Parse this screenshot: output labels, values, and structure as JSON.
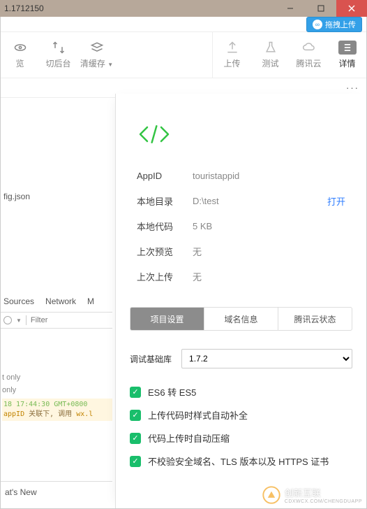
{
  "title": "1.1712150",
  "drag_upload": "拖拽上传",
  "toolbar": {
    "left": [
      {
        "icon": "eye-icon",
        "label": "览"
      },
      {
        "icon": "swap-icon",
        "label": "切后台"
      },
      {
        "icon": "layers-icon",
        "label": "清缓存",
        "has_caret": true
      }
    ],
    "right": [
      {
        "icon": "upload-icon",
        "label": "上传"
      },
      {
        "icon": "flask-icon",
        "label": "测试"
      },
      {
        "icon": "cloud-icon",
        "label": "腾讯云"
      },
      {
        "icon": "menu-icon",
        "label": "详情",
        "active": true
      }
    ]
  },
  "file_dots": "···",
  "left_file": "fig.json",
  "devtools": {
    "tab1": "Sources",
    "tab2": "Network",
    "tab3": "M"
  },
  "filter_placeholder": "Filter",
  "console": {
    "l1": "t only",
    "l2": "only",
    "date": "18 17:44:30 GMT+0800",
    "warn_pre": "appID ",
    "warn_mid1": "关联下",
    "warn_mid2": ", 调用 ",
    "warn_fn": "wx.l"
  },
  "whatsnew": "at's New",
  "detail": {
    "rows": [
      {
        "k": "AppID",
        "v": "touristappid"
      },
      {
        "k": "本地目录",
        "v": "D:\\test",
        "open": "打开"
      },
      {
        "k": "本地代码",
        "v": "5 KB"
      },
      {
        "k": "上次预览",
        "v": "无"
      },
      {
        "k": "上次上传",
        "v": "无"
      }
    ],
    "tabs": [
      {
        "label": "项目设置",
        "active": true
      },
      {
        "label": "域名信息"
      },
      {
        "label": "腾讯云状态"
      }
    ],
    "baselib_label": "调试基础库",
    "baselib_value": "1.7.2",
    "checks": [
      "ES6 转 ES5",
      "上传代码时样式自动补全",
      "代码上传时自动压缩",
      "不校验安全域名、TLS 版本以及 HTTPS 证书"
    ]
  },
  "watermark": {
    "brand": "创新互联",
    "sub": "CDXWCX.COM/CHENGDUAPP"
  }
}
